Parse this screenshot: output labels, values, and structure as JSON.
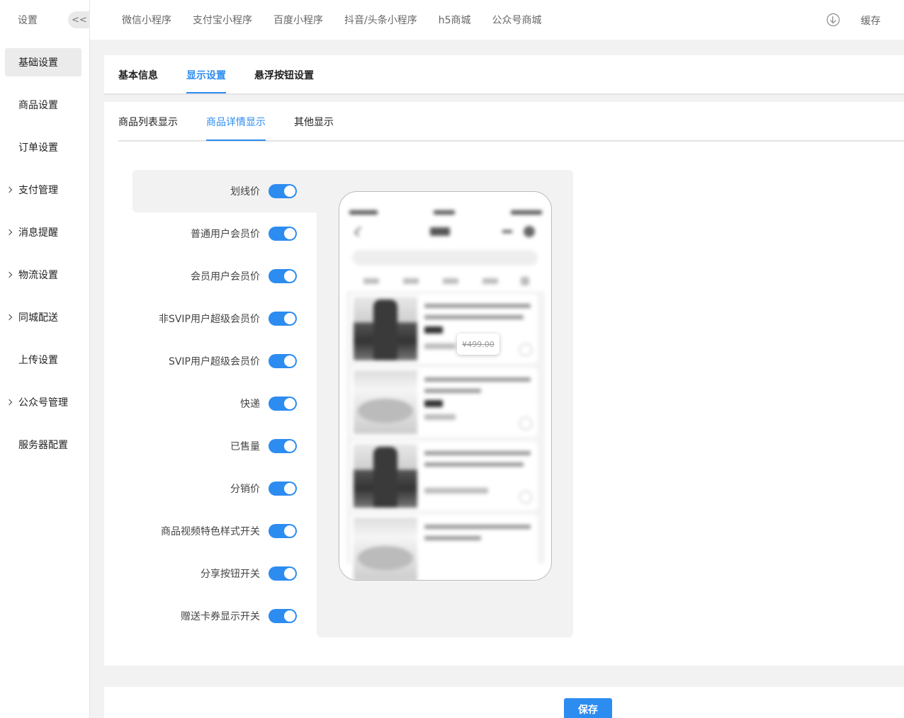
{
  "sidebar": {
    "title": "设置",
    "collapse_label": "<<",
    "items": [
      {
        "label": "基础设置"
      },
      {
        "label": "商品设置"
      },
      {
        "label": "订单设置"
      },
      {
        "label": "支付管理"
      },
      {
        "label": "消息提醒"
      },
      {
        "label": "物流设置"
      },
      {
        "label": "同城配送"
      },
      {
        "label": "上传设置"
      },
      {
        "label": "公众号管理"
      },
      {
        "label": "服务器配置"
      }
    ]
  },
  "topbar": {
    "tabs": [
      "微信小程序",
      "支付宝小程序",
      "百度小程序",
      "抖音/头条小程序",
      "h5商城",
      "公众号商城"
    ],
    "cache_label": "缓存"
  },
  "tabs_primary": [
    "基本信息",
    "显示设置",
    "悬浮按钮设置"
  ],
  "tabs_secondary": [
    "商品列表显示",
    "商品详情显示",
    "其他显示"
  ],
  "settings": [
    {
      "label": "划线价",
      "enabled": true
    },
    {
      "label": "普通用户会员价",
      "enabled": true
    },
    {
      "label": "会员用户会员价",
      "enabled": true
    },
    {
      "label": "非SVIP用户超级会员价",
      "enabled": true
    },
    {
      "label": "SVIP用户超级会员价",
      "enabled": true
    },
    {
      "label": "快递",
      "enabled": true
    },
    {
      "label": "已售量",
      "enabled": true
    },
    {
      "label": "分销价",
      "enabled": true
    },
    {
      "label": "商品视频特色样式开关",
      "enabled": true
    },
    {
      "label": "分享按钮开关",
      "enabled": true
    },
    {
      "label": "赠送卡券显示开关",
      "enabled": true
    }
  ],
  "preview": {
    "tooltip_price": "¥499.00"
  },
  "footer": {
    "save_label": "保存"
  },
  "colors": {
    "accent": "#2d8cf0",
    "page_bg": "#f2f2f2"
  }
}
